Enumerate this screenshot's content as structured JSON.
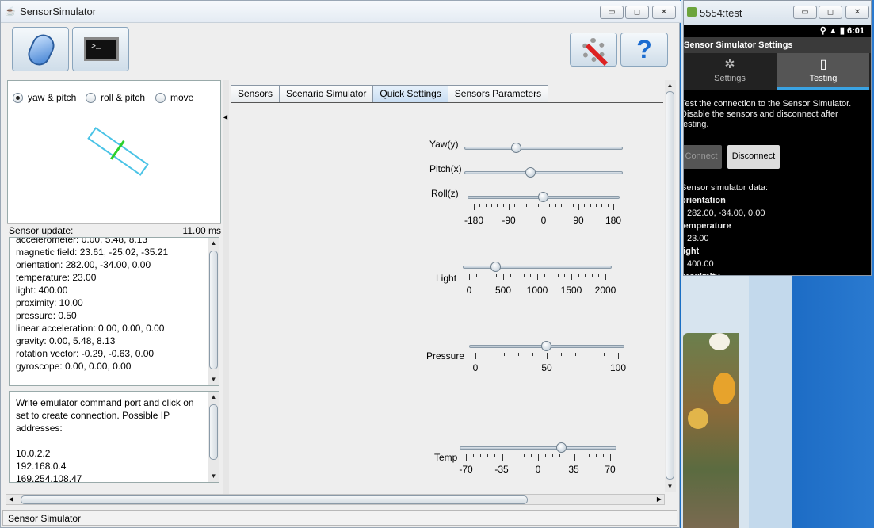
{
  "main_window": {
    "title": "SensorSimulator",
    "controls": {
      "minimize": "▭",
      "maximize": "◻",
      "close": "✕"
    }
  },
  "toolbar": {
    "buttons": [
      {
        "name": "connect-device",
        "icon": "phone-icon"
      },
      {
        "name": "terminal",
        "icon": "terminal-icon",
        "glyph": ">_"
      },
      {
        "name": "settings",
        "icon": "settings-tools-icon"
      },
      {
        "name": "help",
        "icon": "help-icon",
        "glyph": "?"
      }
    ]
  },
  "orientation": {
    "modes": [
      "yaw & pitch",
      "roll & pitch",
      "move"
    ],
    "selected": "yaw & pitch"
  },
  "sensor_update": {
    "label": "Sensor update:",
    "value": "11.00 ms"
  },
  "sensor_values": [
    "accelerometer: 0.00, 5.48, 8.13",
    "magnetic field: 23.61, -25.02, -35.21",
    "orientation: 282.00, -34.00, 0.00",
    "temperature: 23.00",
    "light: 400.00",
    "proximity: 10.00",
    "pressure: 0.50",
    "linear acceleration: 0.00, 0.00, 0.00",
    "gravity: 0.00, 5.48, 8.13",
    "rotation vector: -0.29, -0.63, 0.00",
    "gyroscope: 0.00, 0.00, 0.00"
  ],
  "connection_info": [
    "Write emulator command port and click on",
    "set to create connection. Possible IP",
    "addresses:",
    "",
    "10.0.2.2",
    "192.168.0.4",
    "169.254.108.47"
  ],
  "tabs": [
    "Sensors",
    "Scenario Simulator",
    "Quick Settings",
    "Sensors Parameters"
  ],
  "active_tab": "Quick Settings",
  "quick_settings": {
    "yaw_label": "Yaw(y)",
    "pitch_label": "Pitch(x)",
    "roll_label": "Roll(z)",
    "roll_ticks": [
      "-180",
      "-90",
      "0",
      "90",
      "180"
    ],
    "yaw_value_fraction": 0.33,
    "pitch_value_fraction": 0.42,
    "roll_value": 0,
    "light_label": "Light",
    "light_ticks": [
      "0",
      "500",
      "1000",
      "1500",
      "2000"
    ],
    "light_value": 400,
    "pressure_label": "Pressure",
    "pressure_ticks": [
      "0",
      "50",
      "100"
    ],
    "pressure_value": 50,
    "temp_label": "Temp",
    "temp_ticks": [
      "-70",
      "-35",
      "0",
      "35",
      "70"
    ],
    "temp_value": 23
  },
  "status_bar": "Sensor Simulator",
  "emulator": {
    "title": "5554:test",
    "time": "6:01",
    "app_title": "Sensor Simulator Settings",
    "tabs": [
      "Settings",
      "Testing"
    ],
    "active_tab": "Testing",
    "description": "Test the connection to the Sensor Simulator. Disable the sensors and disconnect after testing.",
    "connect_label": "Connect",
    "disconnect_label": "Disconnect",
    "data_heading": "Sensor simulator data:",
    "data": [
      {
        "label": "orientation",
        "value": "282.00, -34.00, 0.00"
      },
      {
        "label": "temperature",
        "value": "23.00"
      },
      {
        "label": "light",
        "value": "400.00"
      },
      {
        "label": "proximity",
        "value": ""
      }
    ]
  }
}
